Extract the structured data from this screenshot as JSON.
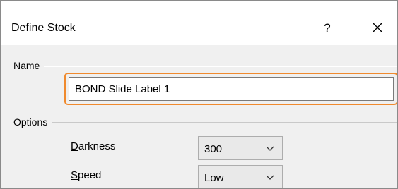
{
  "dialog": {
    "title": "Define Stock",
    "help_label": "?",
    "close_icon": "close-icon"
  },
  "name_section": {
    "label": "Name",
    "input_value": "BOND Slide Label 1"
  },
  "options_section": {
    "label": "Options",
    "darkness": {
      "label_mnemonic": "D",
      "label_rest": "arkness",
      "value": "300"
    },
    "speed": {
      "label_mnemonic": "S",
      "label_rest": "peed",
      "value": "Low"
    }
  },
  "colors": {
    "focus_ring": "#f08a2e",
    "dialog_bg": "#f0f0f0",
    "titlebar_bg": "#ffffff"
  }
}
